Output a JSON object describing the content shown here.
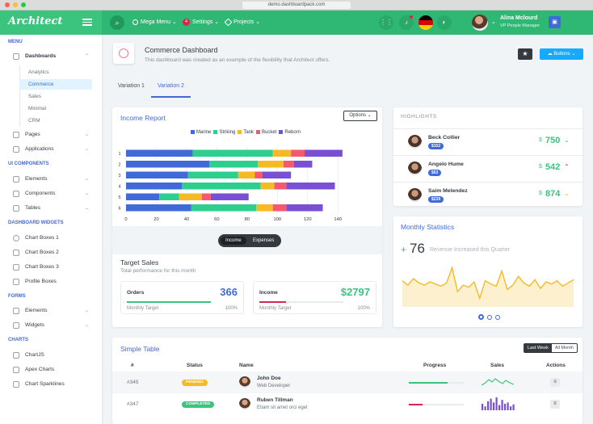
{
  "browser": {
    "url": "demo.dashboardpack.com"
  },
  "header": {
    "logo": "Architect",
    "nav": [
      {
        "label": "Mega Menu ⌄"
      },
      {
        "label": "Settings ⌄",
        "badge": "4"
      },
      {
        "label": "Projects ⌄"
      }
    ],
    "user": {
      "name": "Alina Mclourd",
      "role": "VP People Manager"
    }
  },
  "sidebar": {
    "sections": [
      {
        "title": "MENU"
      },
      {
        "title": "UI COMPONENTS"
      },
      {
        "title": "DASHBOARD WIDGETS"
      },
      {
        "title": "FORMS"
      },
      {
        "title": "CHARTS"
      }
    ],
    "menu": [
      {
        "label": "Dashboards"
      },
      {
        "label": "Pages"
      },
      {
        "label": "Applications"
      }
    ],
    "dash_sub": [
      "Analytics",
      "Commerce",
      "Sales",
      "Minimal",
      "CRM"
    ],
    "ui": [
      {
        "label": "Elements"
      },
      {
        "label": "Components"
      },
      {
        "label": "Tables"
      }
    ],
    "widgets": [
      {
        "label": "Chart Boxes 1"
      },
      {
        "label": "Chart Boxes 2"
      },
      {
        "label": "Chart Boxes 3"
      },
      {
        "label": "Profile Boxes"
      }
    ],
    "forms": [
      {
        "label": "Elements"
      },
      {
        "label": "Widgets"
      }
    ],
    "charts": [
      {
        "label": "ChartJS"
      },
      {
        "label": "Apex Charts"
      },
      {
        "label": "Chart Sparklines"
      }
    ]
  },
  "page": {
    "title": "Commerce Dashboard",
    "subtitle": "This dashboard was created as an example of the flexibility that Architect offers.",
    "buttons_label": "Buttons ⌄",
    "tabs": [
      "Variation 1",
      "Variation 2"
    ]
  },
  "income": {
    "title": "Income Report",
    "options_label": "Options ⌄",
    "toggle": [
      "Income",
      "Expenses"
    ],
    "target_title": "Target Sales",
    "target_sub": "Total performance for this month",
    "orders": {
      "label": "Orders",
      "value": "366",
      "target": "Monthly Target",
      "pct": "100%"
    },
    "income_box": {
      "label": "Income",
      "value": "$2797",
      "target": "Monthly Target",
      "pct": "100%"
    }
  },
  "chart_data": {
    "type": "bar",
    "orientation": "horizontal",
    "stacked": true,
    "categories": [
      "1",
      "2",
      "3",
      "4",
      "5",
      "6"
    ],
    "series": [
      {
        "name": "Marine",
        "color": "#3f6ad8",
        "values": [
          44,
          55,
          41,
          37,
          22,
          43
        ]
      },
      {
        "name": "Striking",
        "color": "#2ccf8e",
        "values": [
          53,
          32,
          33,
          52,
          13,
          43
        ]
      },
      {
        "name": "Tank",
        "color": "#f7b924",
        "values": [
          12,
          17,
          11,
          9,
          15,
          11
        ]
      },
      {
        "name": "Bucket",
        "color": "#f65870",
        "values": [
          9,
          7,
          5,
          8,
          6,
          9
        ]
      },
      {
        "name": "Reborn",
        "color": "#794fd4",
        "values": [
          25,
          12,
          19,
          32,
          25,
          24
        ]
      }
    ],
    "xticks": [
      "0",
      "20",
      "40",
      "60",
      "80",
      "100",
      "120",
      "140"
    ],
    "xlim": [
      0,
      150
    ],
    "grid": true,
    "legend": "top"
  },
  "highlights": {
    "title": "HIGHLIGHTS",
    "rows": [
      {
        "name": "Beck Collier",
        "badge": "$152",
        "value": "750",
        "arrow": "⌄",
        "color": "#3ac47d",
        "arrow_color": "#3ac47d"
      },
      {
        "name": "Angelo Hume",
        "badge": "$53",
        "value": "542",
        "arrow": "⌃",
        "color": "#3ac47d",
        "arrow_color": "#d92550"
      },
      {
        "name": "Saim Melendez",
        "badge": "$239",
        "value": "874",
        "arrow": "⌄",
        "color": "#3ac47d",
        "arrow_color": "#f7b924"
      }
    ]
  },
  "monthly": {
    "title": "Monthly Statistics",
    "plus": "+",
    "value": "76",
    "text": "Revenue Increased this Quarter",
    "spark": [
      46,
      42,
      48,
      44,
      42,
      45,
      43,
      41,
      44,
      58,
      36,
      42,
      40,
      45,
      30,
      46,
      43,
      41,
      55,
      38,
      42,
      50,
      44,
      41,
      47,
      39,
      45,
      43,
      46,
      41,
      44,
      47
    ]
  },
  "table": {
    "title": "Simple Table",
    "ranges": [
      "Last Week",
      "All Month"
    ],
    "headers": [
      "#",
      "Status",
      "Name",
      "Progress",
      "Sales",
      "Actions"
    ],
    "rows": [
      {
        "id": "#345",
        "status": "PENDING",
        "status_color": "#f7b924",
        "name": "John Doe",
        "role": "Web Developer",
        "progress": 0.7,
        "progress_color": "#3ac47d",
        "action": "≡"
      },
      {
        "id": "#347",
        "status": "COMPLETED",
        "status_color": "#3ac47d",
        "name": "Ruben Tillman",
        "role": "Etiam sit amet orci eget",
        "progress": 0.25,
        "progress_color": "#d92550",
        "action": "≡"
      }
    ]
  }
}
